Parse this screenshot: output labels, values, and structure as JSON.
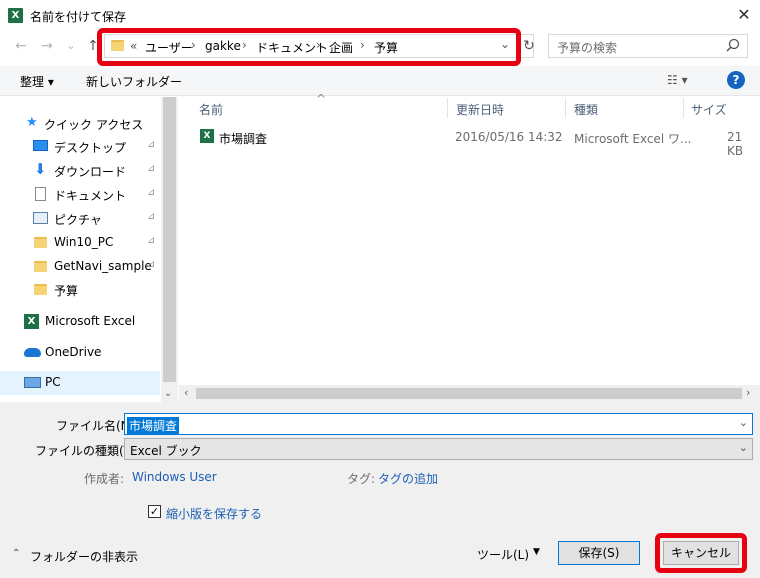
{
  "window": {
    "title": "名前を付けて保存",
    "close_glyph": "✕"
  },
  "nav": {
    "back": "←",
    "forward": "→",
    "recent": "⌄",
    "up": "↑",
    "refresh": "↻"
  },
  "address": {
    "overflow": "«",
    "crumbs": [
      "ユーザー",
      "gakke",
      "ドキュメント",
      "企画",
      "予算"
    ],
    "sep": "›",
    "dropdown": "⌄"
  },
  "search": {
    "placeholder": "予算の検索"
  },
  "toolbar": {
    "organize": "整理 ▾",
    "new_folder": "新しいフォルダー",
    "view_glyph": "☷ ▾",
    "help": "?"
  },
  "sidebar": {
    "quick_access": "クイック アクセス",
    "items": [
      {
        "label": "デスクトップ",
        "icon": "desktop-icon",
        "pinned": true
      },
      {
        "label": "ダウンロード",
        "icon": "download-icon",
        "pinned": true
      },
      {
        "label": "ドキュメント",
        "icon": "document-icon",
        "pinned": true
      },
      {
        "label": "ピクチャ",
        "icon": "pictures-icon",
        "pinned": true
      },
      {
        "label": "Win10_PC",
        "icon": "folder-icon",
        "pinned": true
      },
      {
        "label": "GetNavi_sample",
        "icon": "folder-icon",
        "pinned": true
      },
      {
        "label": "予算",
        "icon": "folder-icon",
        "pinned": false
      }
    ],
    "excel": "Microsoft Excel",
    "onedrive": "OneDrive",
    "pc": "PC",
    "pin_glyph": "📌"
  },
  "filelist": {
    "columns": [
      "名前",
      "更新日時",
      "種類",
      "サイズ"
    ],
    "sort_glyph": "^",
    "rows": [
      {
        "name": "市場調査",
        "date": "2016/05/16 14:32",
        "type": "Microsoft Excel ワ...",
        "size": "21 KB"
      }
    ]
  },
  "form": {
    "filename_label": "ファイル名(N):",
    "filename_value": "市場調査",
    "filetype_label": "ファイルの種類(T):",
    "filetype_value": "Excel ブック",
    "author_label": "作成者:",
    "author_value": "Windows User",
    "tag_label": "タグ:",
    "tag_value": "タグの追加",
    "thumbnail_label": "縮小版を保存する",
    "thumbnail_checked": "✓"
  },
  "footer": {
    "hide_folders": "フォルダーの非表示",
    "tools": "ツール(L)",
    "tools_arrow": "▼",
    "save": "保存(S)",
    "cancel": "キャンセル"
  },
  "colors": {
    "highlight": "#e60012",
    "accent": "#0078d7",
    "link": "#1c5fb4"
  }
}
